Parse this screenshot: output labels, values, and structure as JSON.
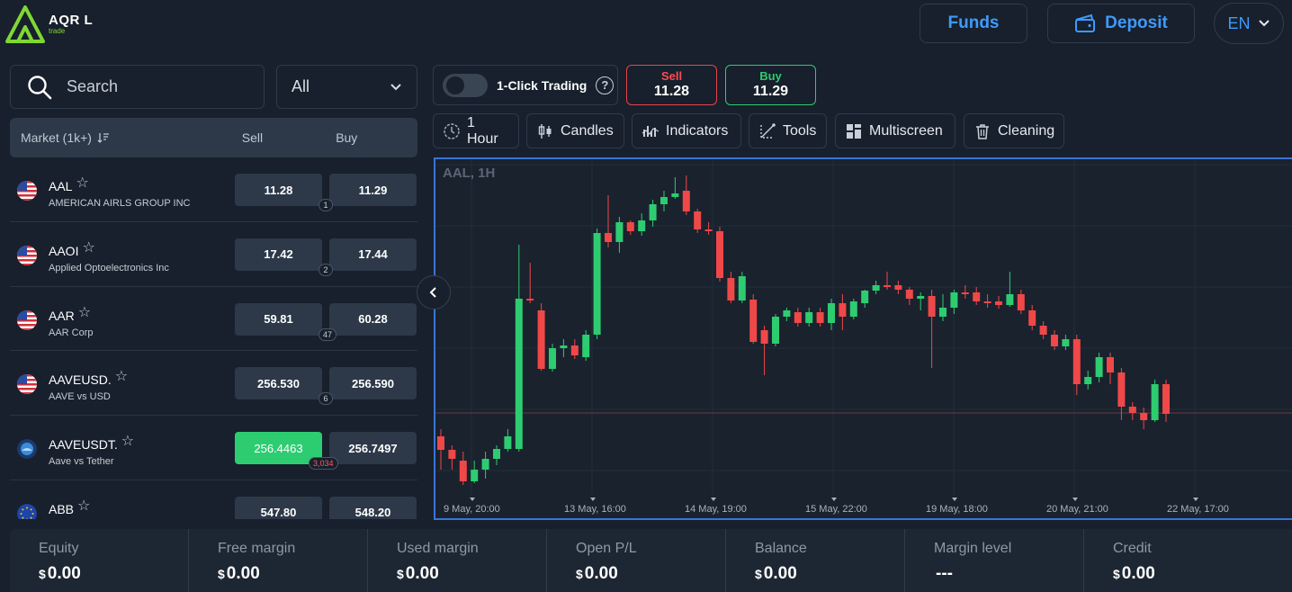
{
  "brand": {
    "name": "AQR L",
    "sub": "trade",
    "accent": "#7fd832"
  },
  "header": {
    "funds_label": "Funds",
    "deposit_label": "Deposit",
    "language": "EN"
  },
  "search": {
    "placeholder": "Search"
  },
  "filter": {
    "selected": "All"
  },
  "market_table": {
    "headers": {
      "market": "Market (1k+)",
      "sell": "Sell",
      "buy": "Buy"
    },
    "rows": [
      {
        "symbol": "AAL",
        "name": "AMERICAN AIRLS GROUP INC",
        "sell": "11.28",
        "buy": "11.29",
        "spread": "1",
        "flag": "us-flag-icon"
      },
      {
        "symbol": "AAOI",
        "name": "Applied Optoelectronics Inc",
        "sell": "17.42",
        "buy": "17.44",
        "spread": "2",
        "flag": "us-flag-icon"
      },
      {
        "symbol": "AAR",
        "name": "AAR Corp",
        "sell": "59.81",
        "buy": "60.28",
        "spread": "47",
        "flag": "us-flag-icon"
      },
      {
        "symbol": "AAVEUSD.",
        "name": "AAVE vs USD",
        "sell": "256.530",
        "buy": "256.590",
        "spread": "6",
        "flag": "us-flag-icon"
      },
      {
        "symbol": "AAVEUSDT.",
        "name": "Aave vs Tether",
        "sell": "256.4463",
        "buy": "256.7497",
        "spread": "3,034",
        "flag": "aave-icon"
      },
      {
        "symbol": "ABB",
        "name": "",
        "sell": "547.80",
        "buy": "548.20",
        "spread": "",
        "flag": "eu-flag-icon"
      }
    ]
  },
  "trading": {
    "one_click_label": "1-Click Trading",
    "sell_label": "Sell",
    "sell_price": "11.28",
    "buy_label": "Buy",
    "buy_price": "11.29"
  },
  "toolbar": {
    "timeframe": "1 Hour",
    "candles": "Candles",
    "indicators": "Indicators",
    "tools": "Tools",
    "multiscreen": "Multiscreen",
    "cleaning": "Cleaning"
  },
  "chart": {
    "label": "AAL, 1H",
    "x_ticks": [
      "9 May, 20:00",
      "13 May, 16:00",
      "14 May, 19:00",
      "15 May, 22:00",
      "19 May, 18:00",
      "20 May, 21:00",
      "22 May, 17:00"
    ],
    "up_color": "#2ecc71",
    "down_color": "#f04848"
  },
  "footer": {
    "stats": [
      {
        "label": "Equity",
        "currency": "$",
        "value": "0.00"
      },
      {
        "label": "Free margin",
        "currency": "$",
        "value": "0.00"
      },
      {
        "label": "Used margin",
        "currency": "$",
        "value": "0.00"
      },
      {
        "label": "Open P/L",
        "currency": "$",
        "value": "0.00"
      },
      {
        "label": "Balance",
        "currency": "$",
        "value": "0.00"
      },
      {
        "label": "Margin level",
        "currency": "",
        "value": "---"
      },
      {
        "label": "Credit",
        "currency": "$",
        "value": "0.00"
      }
    ]
  }
}
